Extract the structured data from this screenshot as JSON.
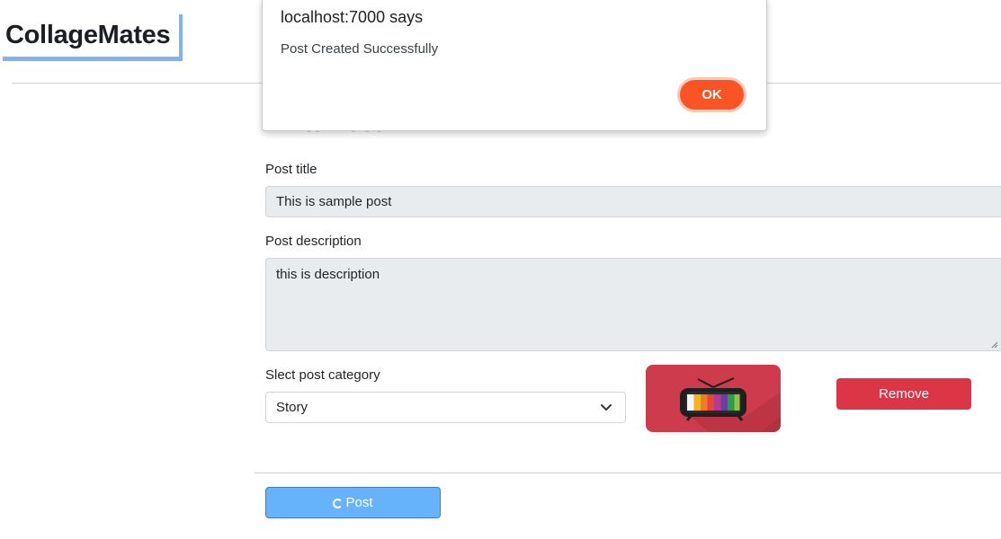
{
  "brand": {
    "name": "CollageMates"
  },
  "form": {
    "heading": "Write Post",
    "title_label": "Post title",
    "title_value": "This is sample post",
    "description_label": "Post description",
    "description_value": "this is description",
    "category_label": "Slect post category",
    "category_value": "Story",
    "remove_label": "Remove",
    "post_label": "Post"
  },
  "dialog": {
    "title": "localhost:7000 says",
    "message": "Post Created Successfully",
    "ok_label": "OK"
  },
  "colors": {
    "accent": "#7db4f2",
    "danger": "#dc3545",
    "primary_light": "#66b2fb",
    "dialog_ok": "#fb5424"
  }
}
